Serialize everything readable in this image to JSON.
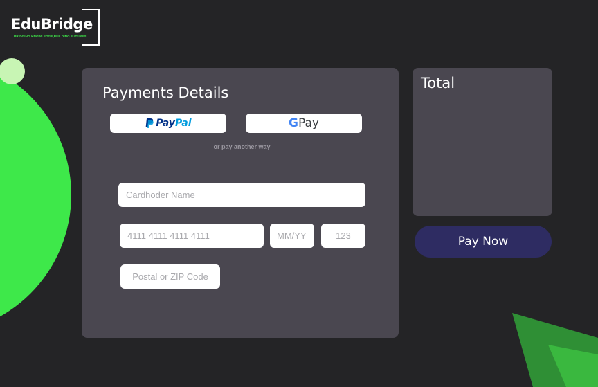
{
  "brand": {
    "name": "EduBridge",
    "tagline": "BRIDGING KNOWLEDGE,BUILDING FUTURES."
  },
  "payment": {
    "title": "Payments Details",
    "wallets": {
      "paypal": {
        "pay": "Pay",
        "pal": "Pal",
        "icon": "paypal-logo-icon"
      },
      "gpay": {
        "g": "G",
        "label": "Pay",
        "icon": "google-g-icon"
      }
    },
    "divider_text": "or pay another way",
    "fields": {
      "cardholder_placeholder": "Cardhoder Name",
      "card_number_placeholder": "4111 4111 4111 4111",
      "expiry_placeholder": "MM/YY",
      "cvc_placeholder": "123",
      "postal_placeholder": "Postal or ZIP Code"
    }
  },
  "summary": {
    "title": "Total"
  },
  "actions": {
    "pay_now": "Pay Now"
  },
  "colors": {
    "background": "#242426",
    "card": "#4a4750",
    "accent_green": "#3ee84a",
    "pay_button": "#2e2c62",
    "paypal_dark": "#003087",
    "paypal_light": "#009cde"
  }
}
